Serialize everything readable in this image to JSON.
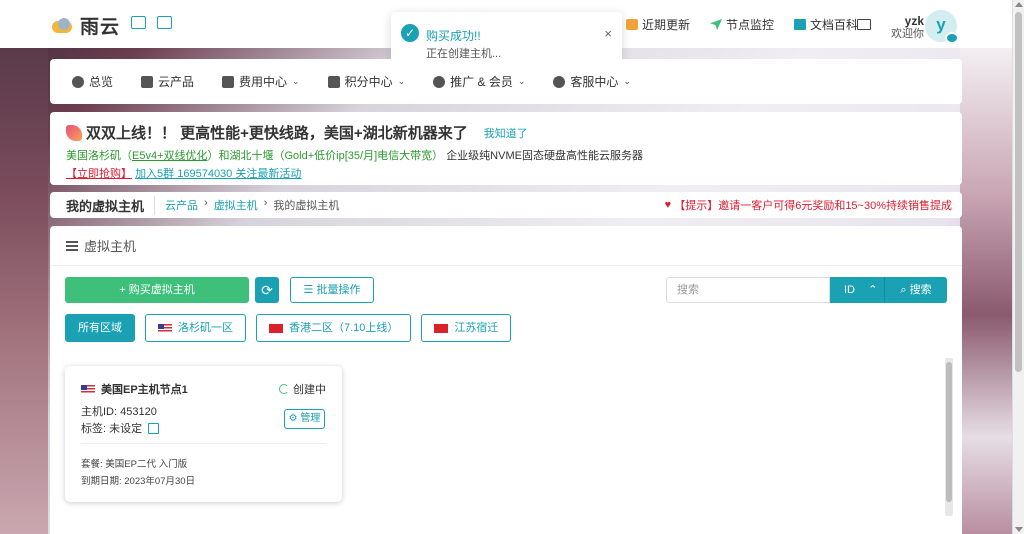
{
  "brand": {
    "name": "雨云"
  },
  "top_nav": {
    "items": [
      {
        "label": "近期更新",
        "icon": "announcement-icon"
      },
      {
        "label": "节点监控",
        "icon": "send-icon"
      },
      {
        "label": "文档百科",
        "icon": "book-icon"
      }
    ]
  },
  "user": {
    "username": "yzk",
    "greeting": "欢迎你",
    "avatar_letter": "y"
  },
  "toast": {
    "title": "购买成功!!",
    "message": "正在创建主机..."
  },
  "main_nav": {
    "items": [
      {
        "label": "总览",
        "dropdown": false
      },
      {
        "label": "云产品",
        "dropdown": false
      },
      {
        "label": "费用中心",
        "dropdown": true
      },
      {
        "label": "积分中心",
        "dropdown": true
      },
      {
        "label": "推广 & 会员",
        "dropdown": true
      },
      {
        "label": "客服中心",
        "dropdown": true
      }
    ]
  },
  "notice": {
    "headline": "双双上线！！ 更高性能+更快线路，美国+湖北新机器来了",
    "dismiss": "我知道了",
    "line2_a": "美国洛杉矶（",
    "line2_b": "E5v4+双线优化",
    "line2_c": "）和",
    "line2_d": "湖北十堰（Gold+低价ip[35/月]电信大带宽）",
    "line2_e": "企业级纯NVME固态硬盘高性能云服务器",
    "line3_a": "【立即抢购】",
    "line3_b": "加入5群 169574030 关注最新活动"
  },
  "breadcrumb": {
    "title": "我的虚拟主机",
    "items": [
      "云产品",
      "虚拟主机",
      "我的虚拟主机"
    ],
    "tip": "【提示】邀请一客户可得6元奖励和15~30%持续销售提成"
  },
  "panel": {
    "heading": "虚拟主机",
    "buy_label": "+ 购买虚拟主机",
    "batch_label": "批量操作",
    "search_placeholder": "搜索",
    "search_field": "ID",
    "search_button": "搜索"
  },
  "regions": [
    {
      "label": "所有区域",
      "active": true,
      "flag": ""
    },
    {
      "label": "洛杉矶一区",
      "active": false,
      "flag": "us"
    },
    {
      "label": "香港二区（7.10上线）",
      "active": false,
      "flag": "hk"
    },
    {
      "label": "江苏宿迁",
      "active": false,
      "flag": "cn"
    }
  ],
  "hosts": [
    {
      "name": "美国EP主机节点1",
      "status": "创建中",
      "host_id_label": "主机ID: 453120",
      "tag_label": "标签: 未设定",
      "manage_label": "管理",
      "plan_label": "套餐: 美国EP二代 入门版",
      "expiry_label": "到期日期: 2023年07月30日"
    }
  ],
  "colors": {
    "accent": "#1aa1b3",
    "success": "#3ec07a",
    "danger": "#e01b2e"
  }
}
